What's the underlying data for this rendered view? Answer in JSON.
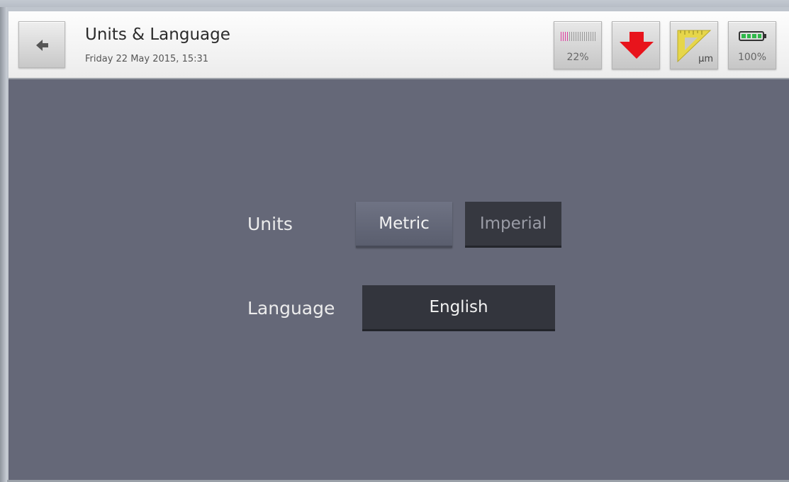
{
  "header": {
    "title": "Units & Language",
    "subtitle": "Friday 22 May 2015, 15:31",
    "back_icon": "back-arrow-icon"
  },
  "status": {
    "memory_percent_label": "22%",
    "memory_fraction": 0.22,
    "download_icon": "download-arrow-icon",
    "units_icon": "ruler-triangle-icon",
    "units_icon_label": "µm",
    "battery_percent_label": "100%",
    "battery_fraction": 1.0
  },
  "settings": {
    "units_label": "Units",
    "units_options": [
      "Metric",
      "Imperial"
    ],
    "units_selected": "Metric",
    "language_label": "Language",
    "language_value": "English"
  },
  "colors": {
    "background": "#656878",
    "selected_button": "#62667a",
    "unselected_button": "#363840",
    "download_arrow": "#e8141c",
    "ruler": "#e6d64a",
    "battery_fill": "#2fb84a",
    "memory_fill": "#e03aa0"
  }
}
